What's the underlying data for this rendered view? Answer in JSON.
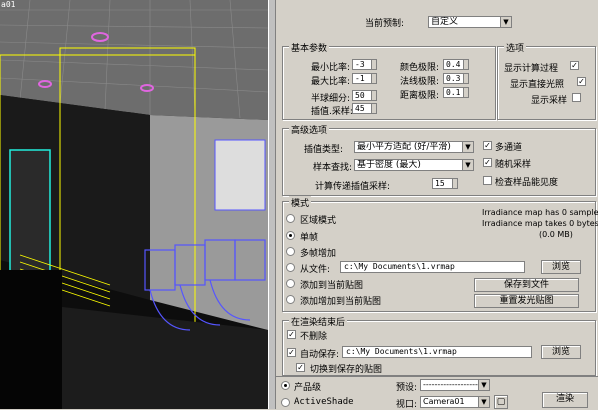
{
  "viewport": {
    "label": "a01"
  },
  "top": {
    "preset_label": "当前预制:",
    "preset_value": "自定义"
  },
  "basic": {
    "title": "基本参数",
    "min_rate_label": "最小比率:",
    "min_rate": "-3",
    "max_rate_label": "最大比率:",
    "max_rate": "-1",
    "hsph_label": "半球细分:",
    "hsph": "50",
    "interp_label": "插值.采样:",
    "interp": "45",
    "clr_thresh_label": "颜色极限:",
    "clr_thresh": "0.4",
    "nrm_thresh_label": "法线极限:",
    "nrm_thresh": "0.3",
    "dist_thresh_label": "距离极限:",
    "dist_thresh": "0.1"
  },
  "options": {
    "title": "选项",
    "show_calc": "显示计算过程",
    "show_direct": "显示直接光照",
    "show_samples": "显示采样"
  },
  "advanced": {
    "title": "高级选项",
    "interp_type_label": "插值类型:",
    "interp_type": "最小平方适配 (好/平滑)",
    "sample_lookup_label": "样本查找:",
    "sample_lookup": "基于密度 (最大)",
    "calc_pass_label": "计算传递插值采样:",
    "calc_pass": "15",
    "multipass": "多通道",
    "randomize": "随机采样",
    "check_vis": "检查样品能见度"
  },
  "mode": {
    "title": "模式",
    "single_block": "区域模式",
    "single_frame": "单帧",
    "multi_frame": "多帧增加",
    "from_file": "从文件:",
    "from_file_path": "c:\\My Documents\\1.vrmap",
    "browse": "浏览",
    "add_to_current": "添加到当前贴图",
    "add_incremental": "添加增加到当前贴图",
    "info1": "Irradiance map has 0 samples",
    "info2": "Irradiance map takes 0 bytes",
    "info3": "(0.0 MB)",
    "save_to_file": "保存到文件",
    "reset_map": "重置发光贴图"
  },
  "after_render": {
    "title": "在渲染结束后",
    "dont_delete": "不删除",
    "auto_save": "自动保存:",
    "auto_save_path": "c:\\My Documents\\1.vrmap",
    "browse": "浏览",
    "switch_to_saved": "切换到保存的贴图"
  },
  "bottom": {
    "production": "产品级",
    "activeshade": "ActiveShade",
    "preset_label": "预设:",
    "preset_value": "--------------------",
    "viewport_label": "视口:",
    "viewport_value": "Camera01",
    "render": "渲染"
  }
}
